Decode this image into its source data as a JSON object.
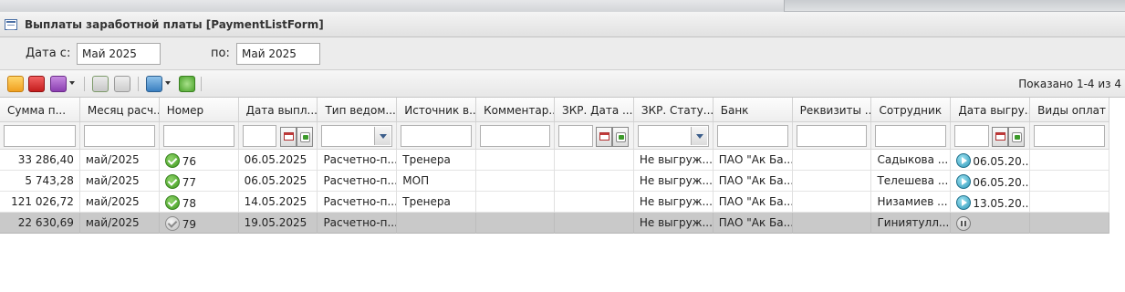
{
  "window": {
    "title": "Выплаты заработной платы [PaymentListForm]"
  },
  "filter": {
    "date_from_label": "Дата с:",
    "date_from_value": "Май 2025",
    "date_to_label": "по:",
    "date_to_value": "Май 2025"
  },
  "toolbar": {
    "buttons": [
      "edit-icon",
      "delete-icon",
      "actions-icon",
      "approve-icon",
      "disapprove-icon",
      "print-icon",
      "refresh-icon"
    ],
    "shown_text": "Показано 1-4 из 4"
  },
  "columns": [
    "Сумма п...",
    "Месяц расч...",
    "Номер",
    "Дата выпл...",
    "Тип ведом...",
    "Источник в...",
    "Комментар...",
    "ЗКР. Дата ...",
    "ЗКР. Стату...",
    "Банк",
    "Реквизиты ...",
    "Сотрудник",
    "Дата выгру...",
    "Виды оплат"
  ],
  "rows": [
    {
      "amount": "33 286,40",
      "month": "май/2025",
      "number": "76",
      "approved": true,
      "date": "06.05.2025",
      "type": "Расчетно-п...",
      "source": "Тренера",
      "comment": "",
      "zkr_date": "",
      "zkr_status": "Не выгруж...",
      "bank": "ПАО \"Ак Ба...",
      "details": "",
      "employee": "Садыкова ...",
      "upload_date": "06.05.20...",
      "upload_state": "play",
      "pay_types": ""
    },
    {
      "amount": "5 743,28",
      "month": "май/2025",
      "number": "77",
      "approved": true,
      "date": "06.05.2025",
      "type": "Расчетно-п...",
      "source": "МОП",
      "comment": "",
      "zkr_date": "",
      "zkr_status": "Не выгруж...",
      "bank": "ПАО \"Ак Ба...",
      "details": "",
      "employee": "Телешева ...",
      "upload_date": "06.05.20...",
      "upload_state": "play",
      "pay_types": ""
    },
    {
      "amount": "121 026,72",
      "month": "май/2025",
      "number": "78",
      "approved": true,
      "date": "14.05.2025",
      "type": "Расчетно-п...",
      "source": "Тренера",
      "comment": "",
      "zkr_date": "",
      "zkr_status": "Не выгруж...",
      "bank": "ПАО \"Ак Ба...",
      "details": "",
      "employee": "Низамиев ...",
      "upload_date": "13.05.20...",
      "upload_state": "play",
      "pay_types": ""
    },
    {
      "amount": "22 630,69",
      "month": "май/2025",
      "number": "79",
      "approved": false,
      "date": "19.05.2025",
      "type": "Расчетно-п...",
      "source": "",
      "comment": "",
      "zkr_date": "",
      "zkr_status": "Не выгруж...",
      "bank": "ПАО \"Ак Ба...",
      "details": "",
      "employee": "Гиниятулл...",
      "upload_date": "",
      "upload_state": "pause",
      "pay_types": ""
    }
  ],
  "selected_row": 3
}
